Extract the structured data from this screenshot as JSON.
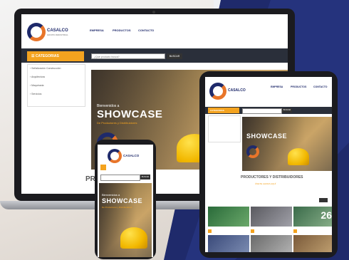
{
  "brand": {
    "name": "CASALCO",
    "tagline": "GRUPO INDUSTRIAL"
  },
  "nav": [
    "EMPRESA",
    "PRODUCTOS",
    "CONTACTO"
  ],
  "sidebar": {
    "header": "CATEGORIAS",
    "items": [
      "Señalización Construcción",
      "Arquitectura",
      "Maquinaria",
      "Servicios"
    ]
  },
  "search": {
    "placeholder": "¿Qué producto busca?",
    "button": "BUSCAR"
  },
  "hero": {
    "welcome": "Bienvenidos a",
    "title": "SHOWCASE",
    "subtitle": "De Productores y Distribuidores"
  },
  "section": {
    "title_partial": "PR          STRIBUIDOR",
    "title_full": "PRODUCTORES Y DISTRIBUIDORES",
    "cta": "ÚNETE AHORA AQUÍ"
  },
  "tablet": {
    "label_thumb": "26"
  },
  "colors": {
    "brand_navy": "#1f2a6b",
    "accent_orange": "#f4a31f",
    "brand_orange": "#e8752a"
  }
}
